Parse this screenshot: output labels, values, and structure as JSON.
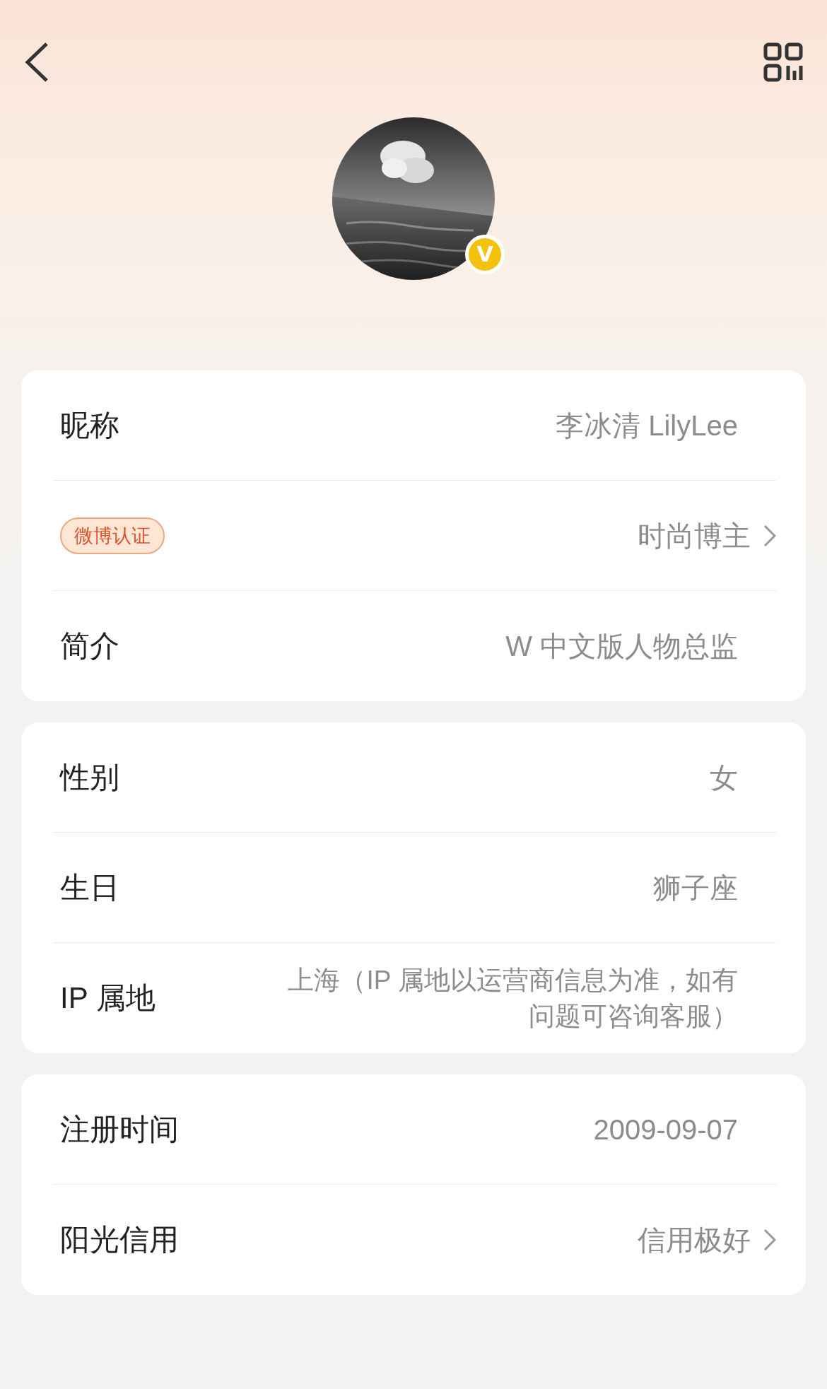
{
  "avatar": {
    "kind": "picture",
    "verified_mark": "V"
  },
  "cards": [
    {
      "rows": [
        {
          "kind": "label",
          "label": "昵称",
          "value": "李冰清 LilyLee",
          "link": false
        },
        {
          "kind": "badge",
          "label": "微博认证",
          "value": "时尚博主",
          "link": true
        },
        {
          "kind": "label",
          "label": "简介",
          "value": "W 中文版人物总监",
          "link": false
        }
      ]
    },
    {
      "rows": [
        {
          "kind": "label",
          "label": "性别",
          "value": "女",
          "link": false
        },
        {
          "kind": "label",
          "label": "生日",
          "value": "狮子座",
          "link": false
        },
        {
          "kind": "label",
          "label": "IP 属地",
          "value": "上海（IP 属地以运营商信息为准，如有问题可咨询客服）",
          "link": false
        }
      ]
    },
    {
      "rows": [
        {
          "kind": "label",
          "label": "注册时间",
          "value": "2009-09-07",
          "link": false
        },
        {
          "kind": "label",
          "label": "阳光信用",
          "value": "信用极好",
          "link": true
        }
      ]
    }
  ]
}
